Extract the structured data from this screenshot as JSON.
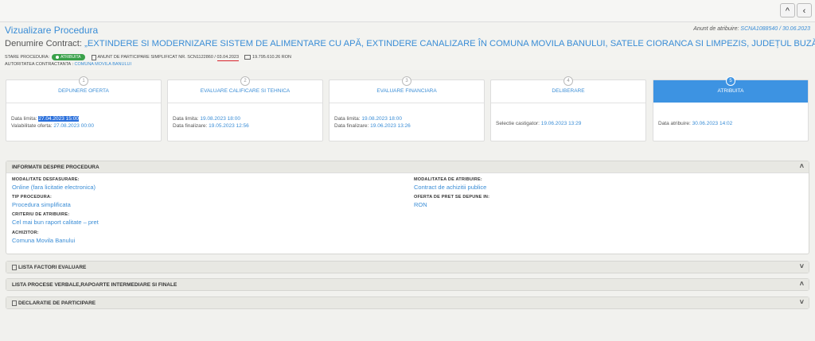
{
  "topbar": {
    "up_icon": "^",
    "back_icon": "‹"
  },
  "header": {
    "page_title": "Vizualizare Procedura",
    "anunt_label": "Anunt de atribuire:",
    "anunt_value": "SCNA1088540 / 30.06.2023",
    "contract_label": "Denumire Contract:",
    "contract_name": "„EXTINDERE SI MODERNIZARE SISTEM DE ALIMENTARE CU APĂ, EXTINDERE CANALIZARE ÎN COMUNA MOVILA BANULUI, SATELE CIORANCA SI LIMPEZIS, JUDEȚUL BUZĂU”",
    "stare_label": "STARE PROCEDURA:",
    "stare_badge": "ATRIBUITA",
    "anunt_part_label": "ANUNT DE PARTICIPARE SIMPLIFICAT NR. SCN1122860 / ",
    "anunt_part_date": "03.04.2023",
    "valoare": "19.795.610.26",
    "moneda": "RON",
    "autoritate_label": "AUTORITATEA CONTRACTANTA :",
    "autoritate_value": "COMUNA MOVILA BANULUI"
  },
  "steps": [
    {
      "num": "1",
      "title": "DEPUNERE OFERTA",
      "l1": "Data limita:",
      "v1": "27.04.2023 15:00",
      "l2": "Valabilitate oferta:",
      "v2": "27.08.2023 00:00"
    },
    {
      "num": "2",
      "title": "EVALUARE CALIFICARE SI TEHNICA",
      "l1": "Data limita:",
      "v1": "19.08.2023 18:00",
      "l2": "Data finalizare:",
      "v2": "19.05.2023 12:56"
    },
    {
      "num": "3",
      "title": "EVALUARE FINANCIARA",
      "l1": "Data limita:",
      "v1": "19.08.2023 18:00",
      "l2": "Data finalizare:",
      "v2": "19.06.2023 13:26"
    },
    {
      "num": "4",
      "title": "DELIBERARE",
      "l1": "Selectie castigator:",
      "v1": "19.06.2023 13:29"
    },
    {
      "num": "5",
      "title": "ATRIBUITA",
      "l1": "Data atribuire:",
      "v1": "30.06.2023 14:02"
    }
  ],
  "info": {
    "title": "INFORMATII DESPRE PROCEDURA",
    "modalitate_desfasurare_label": "MODALITATE DESFASURARE:",
    "modalitate_desfasurare_value": "Online (fara licitatie electronica)",
    "tip_label": "TIP PROCEDURA:",
    "tip_value": "Procedura simplificata",
    "criteriu_label": "CRITERIU DE ATRIBUIRE:",
    "criteriu_value": "Cel mai bun raport calitate – pret",
    "achizitor_label": "ACHIZITOR:",
    "achizitor_value": "Comuna Movila Banului",
    "modalitate_atribuire_label": "MODALITATEA DE ATRIBUIRE:",
    "modalitate_atribuire_value": "Contract de achizitii publice",
    "oferta_label": "OFERTA DE PRET SE DEPUNE IN:",
    "oferta_value": "RON"
  },
  "panels": {
    "factori": "LISTA FACTORI EVALUARE",
    "procese": "LISTA PROCESE VERBALE,RAPOARTE INTERMEDIARE SI FINALE",
    "declaratie": "DECLARATIE DE PARTICIPARE"
  },
  "icons": {
    "chevron_up": "˄",
    "chevron_down": "˅"
  }
}
